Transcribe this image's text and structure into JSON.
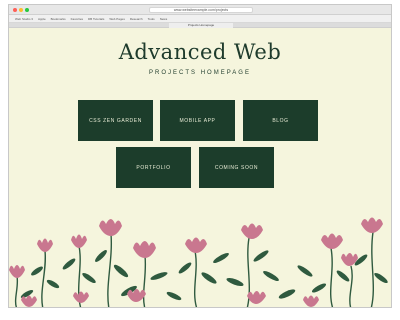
{
  "browser": {
    "url": "www.websiteexample.com/projects",
    "tab_title": "Projects Homepage",
    "bookmarks": [
      "Web Studio 3",
      "Apple",
      "Bookmarks",
      "Favorites",
      "DB Tutorials",
      "Web Pages",
      "Research",
      "Tools",
      "News"
    ]
  },
  "page": {
    "title": "Advanced Web",
    "subtitle": "PROJECTS HOMEPAGE"
  },
  "nav": {
    "items": [
      {
        "label": "CSS ZEN GARDEN"
      },
      {
        "label": "MOBILE APP"
      },
      {
        "label": "BLOG"
      },
      {
        "label": "PORTFOLIO"
      },
      {
        "label": "COMING SOON"
      }
    ]
  },
  "colors": {
    "background": "#f5f5dd",
    "button": "#1c3d2b",
    "accent": "#1e3b2c",
    "flower": "#c9778f",
    "leaf": "#2f5a3f"
  }
}
